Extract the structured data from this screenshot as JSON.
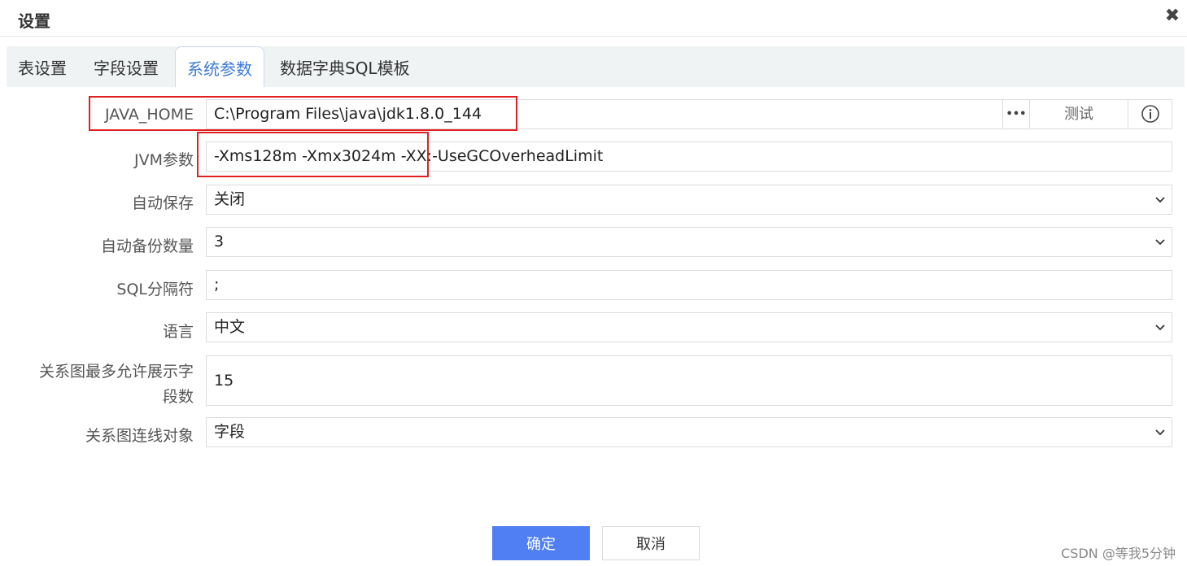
{
  "dialog": {
    "title": "设置",
    "close_glyph": "✖"
  },
  "tabs": [
    {
      "label": "表设置",
      "active": false
    },
    {
      "label": "字段设置",
      "active": false
    },
    {
      "label": "系统参数",
      "active": true
    },
    {
      "label": "数据字典SQL模板",
      "active": false
    }
  ],
  "form": {
    "java_home": {
      "label": "JAVA_HOME",
      "value": "C:\\Program Files\\java\\jdk1.8.0_144",
      "more_glyph": "•••",
      "test_label": "测试",
      "info_glyph": "i"
    },
    "jvm": {
      "label": "JVM参数",
      "value": "-Xms128m -Xmx3024m -XX:-UseGCOverheadLimit"
    },
    "autosave": {
      "label": "自动保存",
      "value": "关闭"
    },
    "backup_count": {
      "label": "自动备份数量",
      "value": "3"
    },
    "sql_separator": {
      "label": "SQL分隔符",
      "value": ";"
    },
    "language": {
      "label": "语言",
      "value": "中文"
    },
    "max_fields": {
      "label_line1": "关系图最多允许展示字",
      "label_line2": "段数",
      "value": "15"
    },
    "link_target": {
      "label": "关系图连线对象",
      "value": "字段"
    }
  },
  "footer": {
    "ok_label": "确定",
    "cancel_label": "取消"
  },
  "watermark": "CSDN @等我5分钟",
  "colors": {
    "accent": "#4f7ff2",
    "active_tab": "#3d7bd6",
    "highlight": "#e02020"
  },
  "icons": [
    "close-icon",
    "more-icon",
    "info-icon",
    "chevron-down-icon"
  ]
}
